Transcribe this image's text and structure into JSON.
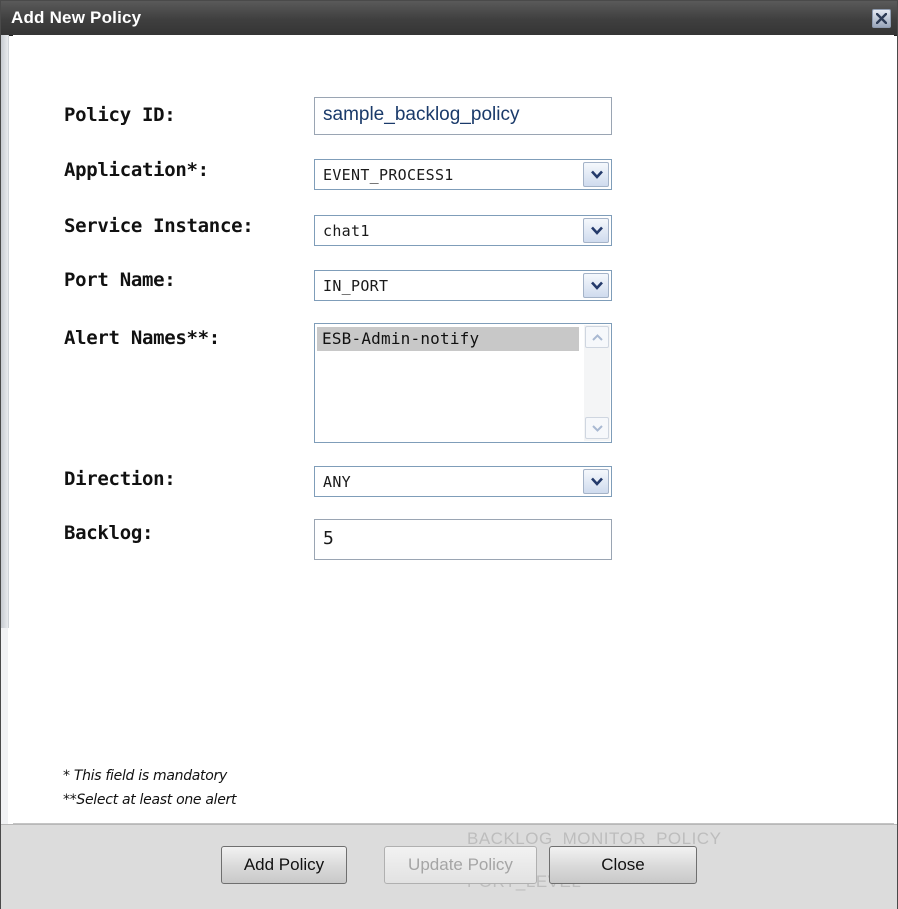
{
  "dialog": {
    "title": "Add New Policy",
    "close_icon": "close-x-icon"
  },
  "form": {
    "policy_id": {
      "label": "Policy ID:",
      "value": "sample_backlog_policy"
    },
    "application": {
      "label": "Application*:",
      "value": "EVENT_PROCESS1"
    },
    "service_instance": {
      "label": "Service Instance:",
      "value": "chat1"
    },
    "port_name": {
      "label": "Port Name:",
      "value": "IN_PORT"
    },
    "alert_names": {
      "label": "Alert Names**:",
      "items": [
        "ESB-Admin-notify"
      ]
    },
    "direction": {
      "label": "Direction:",
      "value": "ANY"
    },
    "backlog": {
      "label": "Backlog:",
      "value": "5"
    }
  },
  "notes": {
    "mandatory": "* This field is mandatory",
    "select_alert": "**Select at least one alert"
  },
  "background_text": {
    "line1": "BACKLOG_MONITOR_POLICY",
    "line2": "PORT_LEVEL"
  },
  "buttons": {
    "add": "Add Policy",
    "update": "Update Policy",
    "close": "Close"
  }
}
